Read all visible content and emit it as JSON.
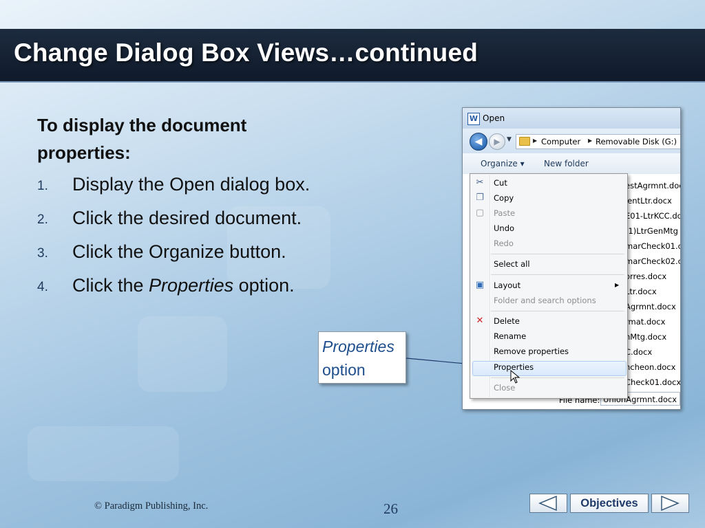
{
  "slide": {
    "title": "Change Dialog Box Views…continued",
    "intro": "To display the document properties:",
    "steps": [
      {
        "num": "1.",
        "text": "Display the Open dialog box."
      },
      {
        "num": "2.",
        "text": "Click the desired document."
      },
      {
        "num": "3.",
        "text": "Click the Organize button."
      },
      {
        "num": "4.",
        "text_before": "Click the ",
        "text_em": "Properties",
        "text_after": " option."
      }
    ],
    "callout": {
      "line1": "Properties",
      "line2": "option"
    },
    "footer": {
      "copyright": "© Paradigm Publishing, Inc.",
      "page": "26"
    },
    "nav": {
      "objectives": "Objectives"
    }
  },
  "dialog": {
    "title": "Open",
    "app_icon_letter": "W",
    "breadcrumb": [
      "Computer",
      "Removable Disk (G:)"
    ],
    "toolbar": {
      "organize": "Organize ▾",
      "new_folder": "New folder"
    },
    "files": [
      "estAgrmnt.doc",
      "ientLtr.docx",
      "E01-LtrKCC.do",
      "(1)LtrGenMtg",
      "marCheck01.c",
      "marCheck02.c",
      "orres.docx",
      "Ltr.docx",
      "Agrmnt.docx",
      "rmat.docx",
      "nMtg.docx",
      "C.docx",
      "ncheon.docx",
      "Check01.docx"
    ],
    "file_name_label": "File name:",
    "file_name_value": "UnionAgrmnt.docx"
  },
  "organize_menu": {
    "items": [
      {
        "label": "Cut",
        "disabled": false,
        "icon": "scissors-icon"
      },
      {
        "label": "Copy",
        "disabled": false,
        "icon": "copy-icon"
      },
      {
        "label": "Paste",
        "disabled": true,
        "icon": "paste-icon"
      },
      {
        "label": "Undo",
        "disabled": false
      },
      {
        "label": "Redo",
        "disabled": true
      },
      {
        "label": "Select all",
        "disabled": false
      },
      {
        "label": "Layout",
        "disabled": false,
        "icon": "layout-icon",
        "submenu": true
      },
      {
        "label": "Folder and search options",
        "disabled": true
      },
      {
        "label": "Delete",
        "disabled": false,
        "icon": "delete-x-icon"
      },
      {
        "label": "Rename",
        "disabled": false
      },
      {
        "label": "Remove properties",
        "disabled": false
      },
      {
        "label": "Properties",
        "disabled": false,
        "highlighted": true
      },
      {
        "label": "Close",
        "disabled": true
      }
    ]
  }
}
